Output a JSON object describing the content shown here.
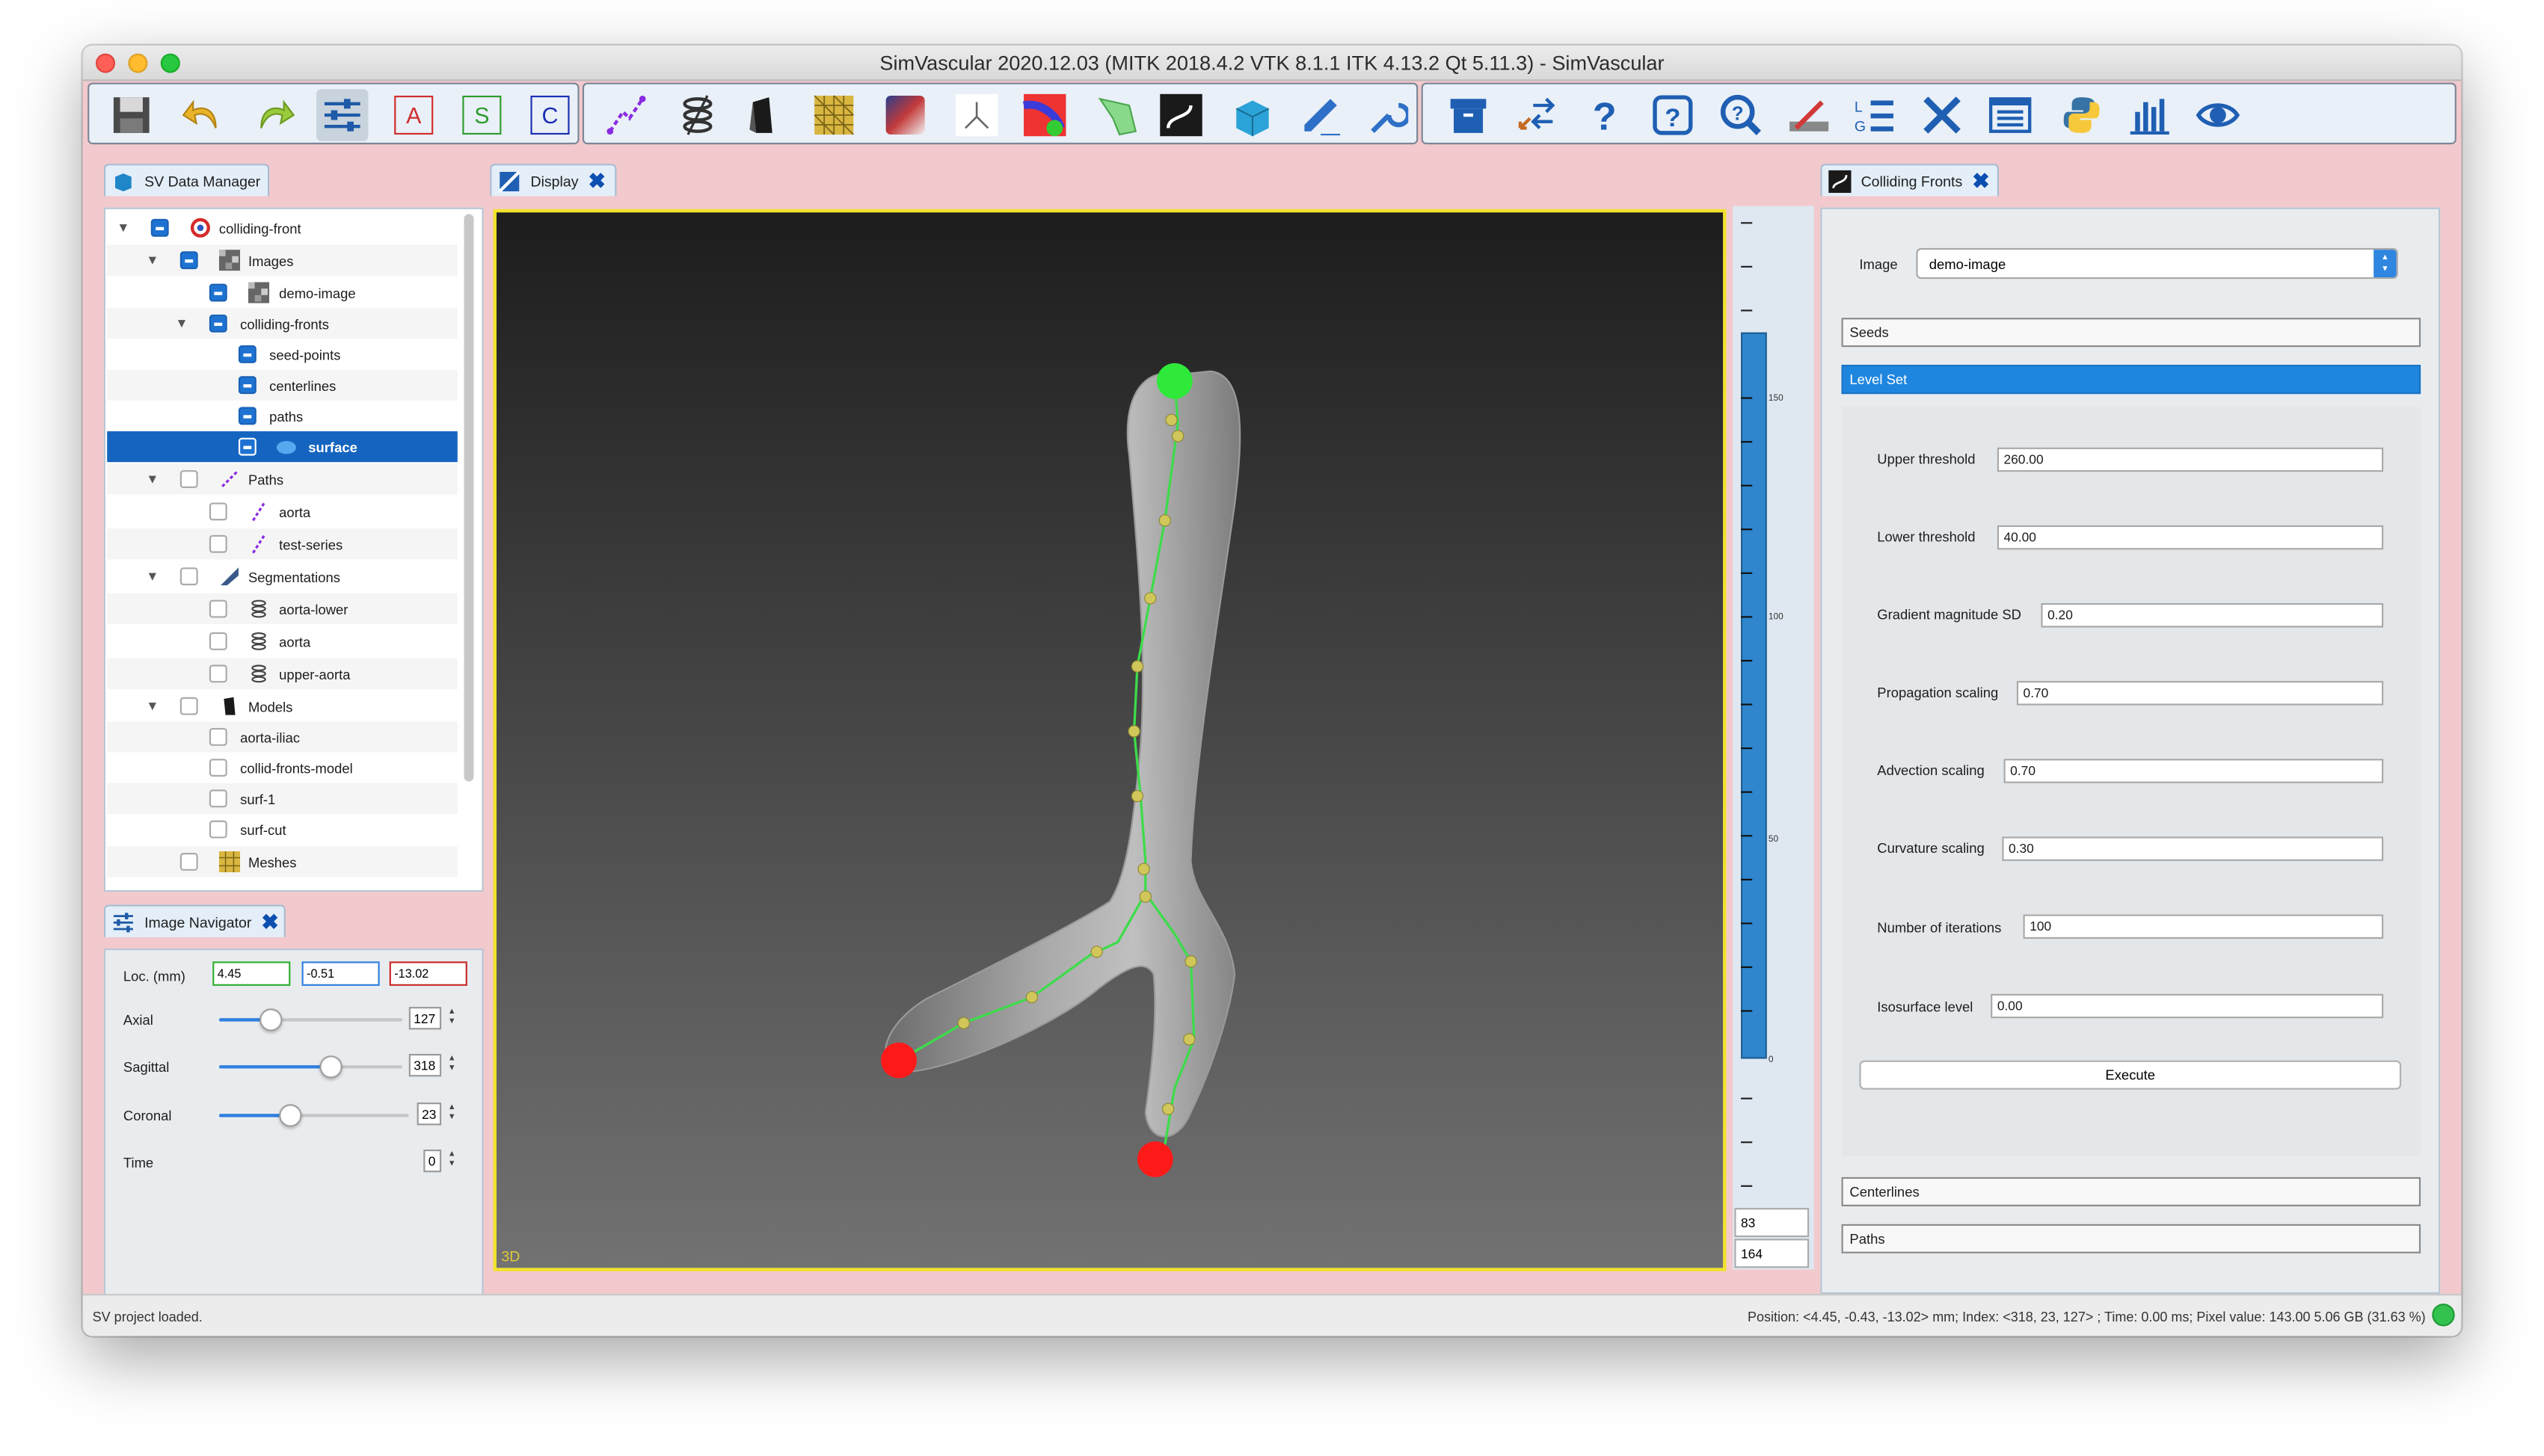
{
  "window": {
    "title": "SimVascular 2020.12.03 (MITK 2018.4.2 VTK 8.1.1 ITK 4.13.2 Qt 5.11.3) - SimVascular"
  },
  "toolbar": {
    "text_buttons": {
      "a": "A",
      "s": "S",
      "c": "C"
    },
    "icons": [
      "save-icon",
      "undo-icon",
      "redo-icon",
      "sliders-icon",
      "a-icon",
      "s-icon",
      "c-icon",
      "path-tool-icon",
      "segmentation-tool-icon",
      "model-tool-icon",
      "mesh-tool-icon",
      "simulation-tool-icon",
      "purkinje-icon",
      "perfusion-icon",
      "imaging-icon",
      "romsim-icon",
      "colliding-fronts-icon",
      "box-icon",
      "pencil-icon",
      "wrench-icon",
      "archive-icon",
      "convert-icon",
      "help-icon",
      "about-icon",
      "zoom-help-icon",
      "measure-icon",
      "log-icon",
      "tools-icon",
      "list-icon",
      "python-icon",
      "chart-icon",
      "eye-icon"
    ]
  },
  "data_manager": {
    "tab_label": "SV Data Manager",
    "tree": [
      {
        "label": "colliding-front",
        "level": 0
      },
      {
        "label": "Images",
        "level": 1
      },
      {
        "label": "demo-image",
        "level": 2
      },
      {
        "label": "colliding-fronts",
        "level": 1
      },
      {
        "label": "seed-points",
        "level": 2
      },
      {
        "label": "centerlines",
        "level": 2
      },
      {
        "label": "paths",
        "level": 2
      },
      {
        "label": "surface",
        "level": 2
      },
      {
        "label": "Paths",
        "level": 1
      },
      {
        "label": "aorta",
        "level": 2
      },
      {
        "label": "test-series",
        "level": 2
      },
      {
        "label": "Segmentations",
        "level": 1
      },
      {
        "label": "aorta-lower",
        "level": 2
      },
      {
        "label": "aorta",
        "level": 2
      },
      {
        "label": "upper-aorta",
        "level": 2
      },
      {
        "label": "Models",
        "level": 1
      },
      {
        "label": "aorta-iliac",
        "level": 2
      },
      {
        "label": "collid-fronts-model",
        "level": 2
      },
      {
        "label": "surf-1",
        "level": 2
      },
      {
        "label": "surf-cut",
        "level": 2
      },
      {
        "label": "Meshes",
        "level": 1
      }
    ]
  },
  "image_navigator": {
    "tab_label": "Image Navigator",
    "loc_label": "Loc. (mm)",
    "loc_x": "4.45",
    "loc_y": "-0.51",
    "loc_z": "-13.02",
    "axial_label": "Axial",
    "axial_value": "127",
    "axial_fraction": 0.28,
    "sagittal_label": "Sagittal",
    "sagittal_value": "318",
    "sagittal_fraction": 0.61,
    "coronal_label": "Coronal",
    "coronal_value": "23",
    "coronal_fraction": 0.38,
    "time_label": "Time",
    "time_value": "0"
  },
  "display": {
    "tab_label": "Display",
    "view_label": "3D"
  },
  "level_window": {
    "ticks": [
      "150",
      "100",
      "50",
      "0"
    ],
    "upper_box": "83",
    "lower_box": "164"
  },
  "colliding_fronts": {
    "tab_label": "Colliding Fronts",
    "image_label": "Image",
    "image_value": "demo-image",
    "sections": {
      "seeds": "Seeds",
      "level_set": "Level Set",
      "centerlines": "Centerlines",
      "paths": "Paths"
    },
    "params": [
      {
        "label": "Upper threshold",
        "value": "260.00"
      },
      {
        "label": "Lower threshold",
        "value": "40.00"
      },
      {
        "label": "Gradient magnitude SD",
        "value": "0.20"
      },
      {
        "label": "Propagation scaling",
        "value": "0.70"
      },
      {
        "label": "Advection scaling",
        "value": "0.70"
      },
      {
        "label": "Curvature scaling",
        "value": "0.30"
      },
      {
        "label": "Number of iterations",
        "value": "100"
      },
      {
        "label": "Isosurface level",
        "value": "0.00"
      }
    ],
    "execute_label": "Execute"
  },
  "status": {
    "left": "SV project loaded.",
    "right": "Position: <4.45, -0.43, -13.02> mm; Index: <318, 23, 127> ; Time: 0.00 ms; Pixel value: 143.00   5.06 GB (31.63 %)"
  },
  "colors": {
    "accent": "#1f86e0",
    "selection": "#1565c0",
    "seed_start": "#2ee83a",
    "seed_end": "#ff1a1a",
    "viewport_border": "#f2e22a"
  }
}
